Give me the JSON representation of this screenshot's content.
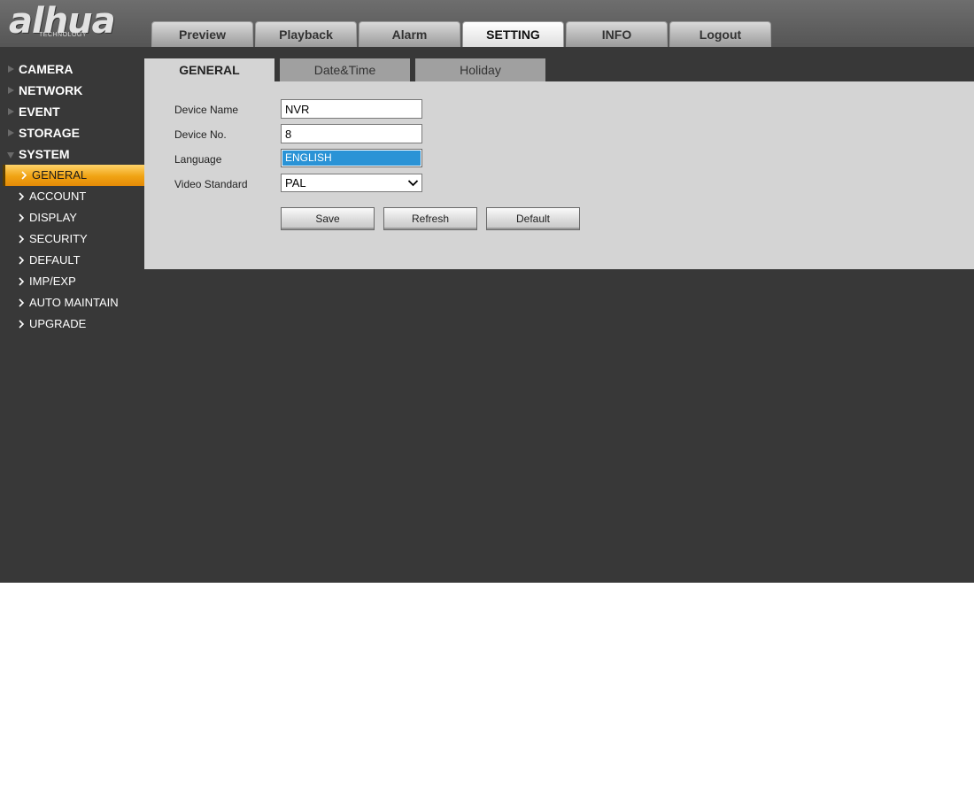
{
  "logo": {
    "text": "alhua",
    "subtext": "TECHNOLOGY"
  },
  "top_nav": [
    {
      "label": "Preview",
      "active": false
    },
    {
      "label": "Playback",
      "active": false
    },
    {
      "label": "Alarm",
      "active": false
    },
    {
      "label": "SETTING",
      "active": true
    },
    {
      "label": "INFO",
      "active": false
    },
    {
      "label": "Logout",
      "active": false
    }
  ],
  "sidebar": {
    "groups": [
      {
        "label": "CAMERA",
        "open": false
      },
      {
        "label": "NETWORK",
        "open": false
      },
      {
        "label": "EVENT",
        "open": false
      },
      {
        "label": "STORAGE",
        "open": false
      },
      {
        "label": "SYSTEM",
        "open": true
      }
    ],
    "system_items": [
      {
        "label": "GENERAL",
        "active": true
      },
      {
        "label": "ACCOUNT",
        "active": false
      },
      {
        "label": "DISPLAY",
        "active": false
      },
      {
        "label": "SECURITY",
        "active": false
      },
      {
        "label": "DEFAULT",
        "active": false
      },
      {
        "label": "IMP/EXP",
        "active": false
      },
      {
        "label": "AUTO MAINTAIN",
        "active": false
      },
      {
        "label": "UPGRADE",
        "active": false
      }
    ]
  },
  "sub_tabs": [
    {
      "label": "GENERAL",
      "active": true
    },
    {
      "label": "Date&Time",
      "active": false
    },
    {
      "label": "Holiday",
      "active": false
    }
  ],
  "form": {
    "device_name": {
      "label": "Device Name",
      "value": "NVR"
    },
    "device_no": {
      "label": "Device No.",
      "value": "8"
    },
    "language": {
      "label": "Language",
      "value": "ENGLISH"
    },
    "video_standard": {
      "label": "Video Standard",
      "value": "PAL"
    }
  },
  "buttons": {
    "save": "Save",
    "refresh": "Refresh",
    "default": "Default"
  },
  "colors": {
    "accent": "#f0a313",
    "selection": "#2a93d6",
    "background": "#383838",
    "panel": "#d4d4d4"
  },
  "icons": {
    "group": "triangle-icon",
    "item": "chevron-right-icon",
    "select": "chevron-down-icon"
  }
}
